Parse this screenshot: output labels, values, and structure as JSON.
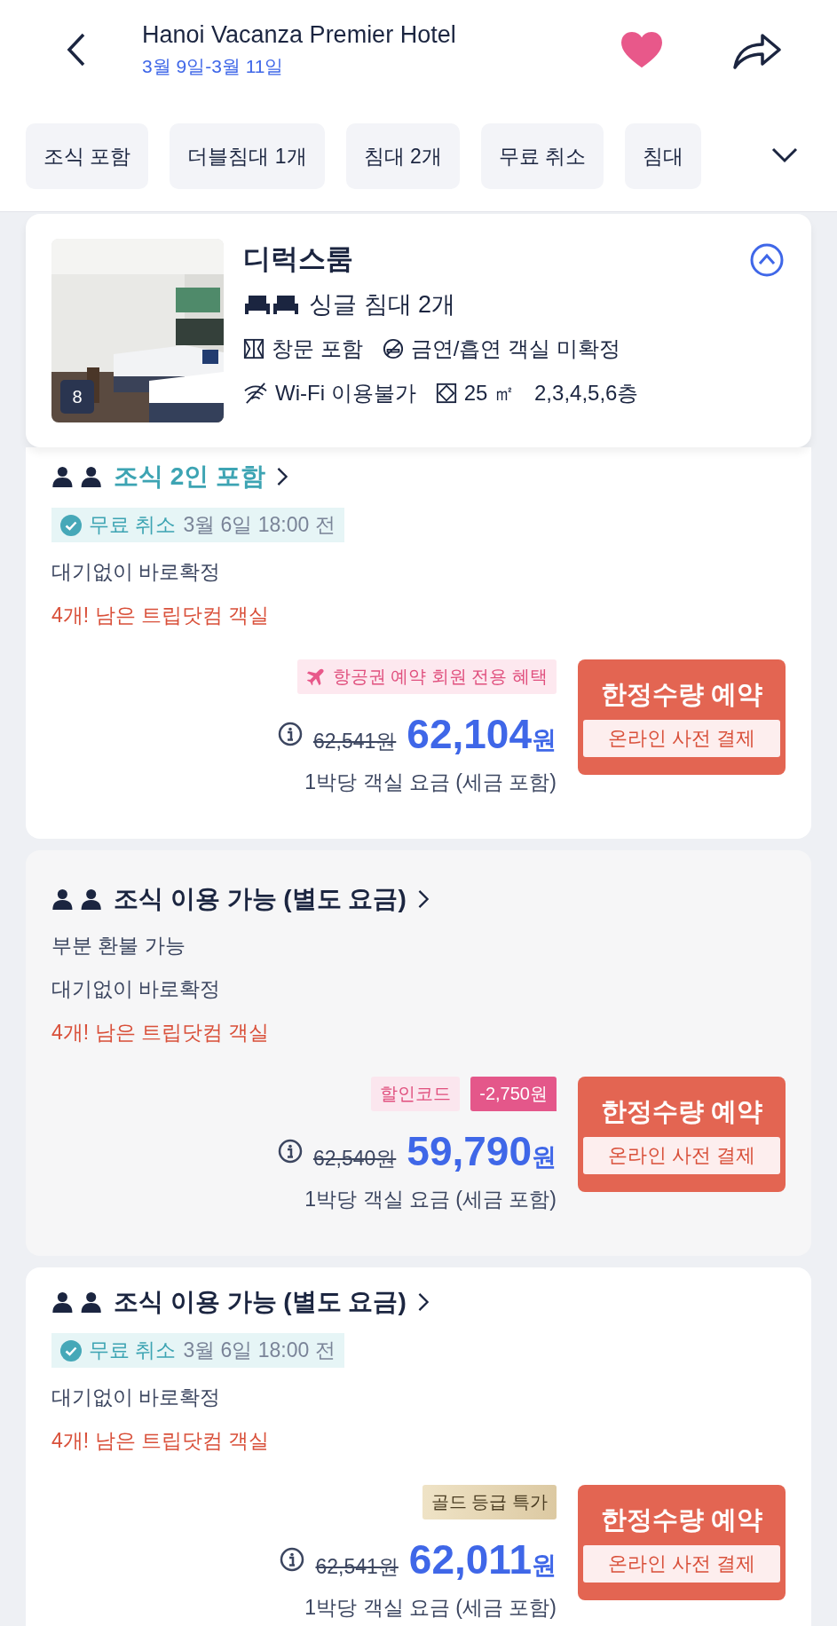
{
  "header": {
    "title": "Hanoi Vacanza Premier Hotel",
    "dates": "3월 9일-3월 11일",
    "favorite": true
  },
  "filters": [
    {
      "label": "조식 포함",
      "selected": false
    },
    {
      "label": "더블침대 1개",
      "selected": false
    },
    {
      "label": "침대 2개",
      "selected": false
    },
    {
      "label": "무료 취소",
      "selected": false
    },
    {
      "label": "침대",
      "selected": false
    }
  ],
  "room": {
    "name": "디럭스룸",
    "expanded": true,
    "photo_count": "8",
    "beds": "싱글 침대 2개",
    "features": [
      {
        "kind": "window",
        "text": "창문 포함"
      },
      {
        "kind": "smoking",
        "text": "금연/흡연 객실 미확정"
      },
      {
        "kind": "wifi",
        "text": "Wi-Fi 이용불가"
      },
      {
        "kind": "area",
        "text": "25 ㎡"
      },
      {
        "kind": "floors",
        "text": "2,3,4,5,6층"
      }
    ]
  },
  "offers": [
    {
      "selected": false,
      "breakfast_included": true,
      "title": "조식 2인 포함",
      "cancellation": {
        "kind": "free",
        "label": "무료 취소",
        "deadline": "3월 6일 18:00 전"
      },
      "lines": [
        "대기없이 바로확정"
      ],
      "availability": "4개! 남은 트립닷컴 객실",
      "badges": [
        {
          "kind": "flight",
          "text": "항공권 예약 회원 전용 혜택"
        }
      ],
      "original_price": "62,541원",
      "price": "62,104",
      "currency": "원",
      "note": "1박당 객실 요금 (세금 포함)",
      "button": {
        "label": "한정수량 예약",
        "sub": "온라인 사전 결제"
      }
    },
    {
      "selected": true,
      "breakfast_included": false,
      "title": "조식 이용 가능 (별도 요금)",
      "cancellation": {
        "kind": "partial",
        "label": "부분 환불 가능"
      },
      "lines": [
        "대기없이 바로확정"
      ],
      "availability": "4개! 남은 트립닷컴 객실",
      "badges": [
        {
          "kind": "code",
          "text": "할인코드"
        },
        {
          "kind": "discount",
          "text": "-2,750원"
        }
      ],
      "original_price": "62,540원",
      "price": "59,790",
      "currency": "원",
      "note": "1박당 객실 요금 (세금 포함)",
      "button": {
        "label": "한정수량 예약",
        "sub": "온라인 사전 결제"
      }
    },
    {
      "selected": false,
      "breakfast_included": false,
      "title": "조식 이용 가능 (별도 요금)",
      "cancellation": {
        "kind": "free",
        "label": "무료 취소",
        "deadline": "3월 6일 18:00 전"
      },
      "lines": [
        "대기없이 바로확정"
      ],
      "availability": "4개! 남은 트립닷컴 객실",
      "badges": [
        {
          "kind": "gold",
          "text": "골드 등급 특가"
        }
      ],
      "original_price": "62,541원",
      "price": "62,011",
      "currency": "원",
      "note": "1박당 객실 요금 (세금 포함)",
      "button": {
        "label": "한정수량 예약",
        "sub": "온라인 사전 결제"
      }
    }
  ]
}
